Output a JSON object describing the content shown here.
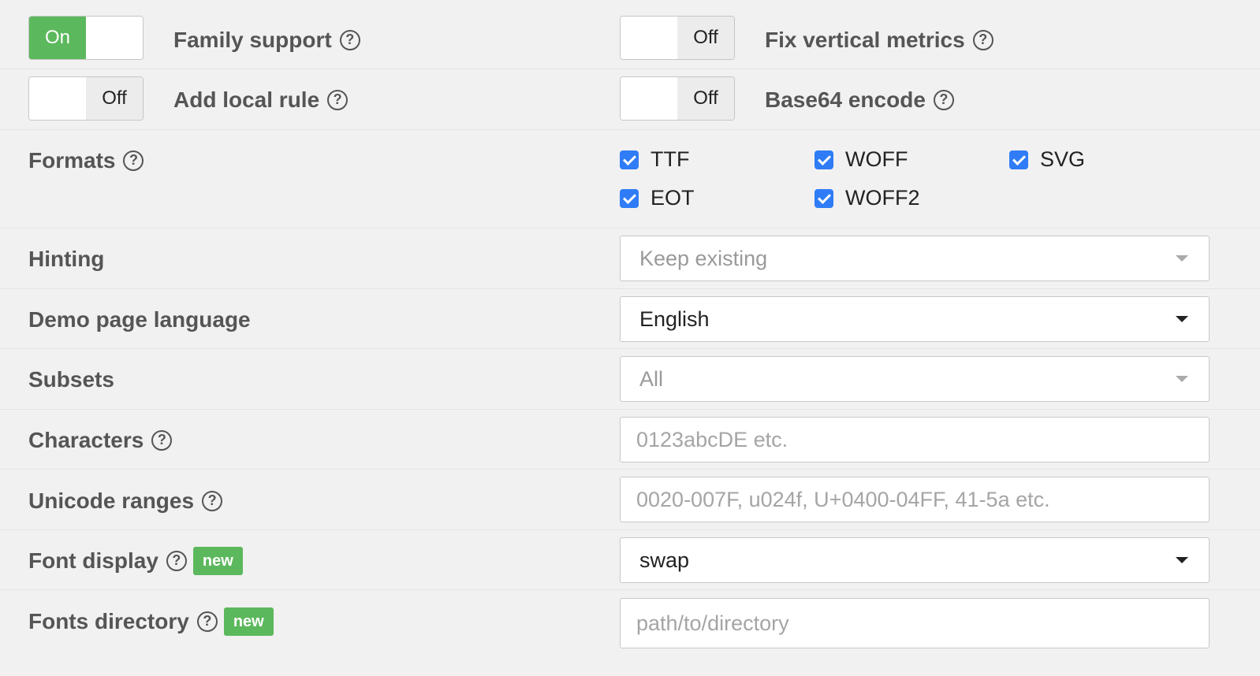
{
  "toggles": {
    "family_support": {
      "state": "On",
      "label": "Family support"
    },
    "add_local_rule": {
      "state": "Off",
      "label": "Add local rule"
    },
    "fix_vertical_metrics": {
      "state": "Off",
      "label": "Fix vertical metrics"
    },
    "base64_encode": {
      "state": "Off",
      "label": "Base64 encode"
    }
  },
  "help_glyph": "?",
  "formats": {
    "label": "Formats",
    "options": [
      {
        "label": "TTF",
        "checked": true
      },
      {
        "label": "WOFF",
        "checked": true
      },
      {
        "label": "SVG",
        "checked": true
      },
      {
        "label": "EOT",
        "checked": true
      },
      {
        "label": "WOFF2",
        "checked": true
      }
    ]
  },
  "hinting": {
    "label": "Hinting",
    "value": "Keep existing"
  },
  "demo_language": {
    "label": "Demo page language",
    "value": "English"
  },
  "subsets": {
    "label": "Subsets",
    "value": "All"
  },
  "characters": {
    "label": "Characters",
    "placeholder": "0123abcDE etc."
  },
  "unicode_ranges": {
    "label": "Unicode ranges",
    "placeholder": "0020-007F, u024f, U+0400-04FF, 41-5a etc."
  },
  "font_display": {
    "label": "Font display",
    "badge": "new",
    "value": "swap"
  },
  "fonts_directory": {
    "label": "Fonts directory",
    "badge": "new",
    "placeholder": "path/to/directory"
  },
  "colors": {
    "on_green": "#5cb85c",
    "checkbox_blue": "#2f7cf6",
    "badge_green": "#5cb85c"
  }
}
